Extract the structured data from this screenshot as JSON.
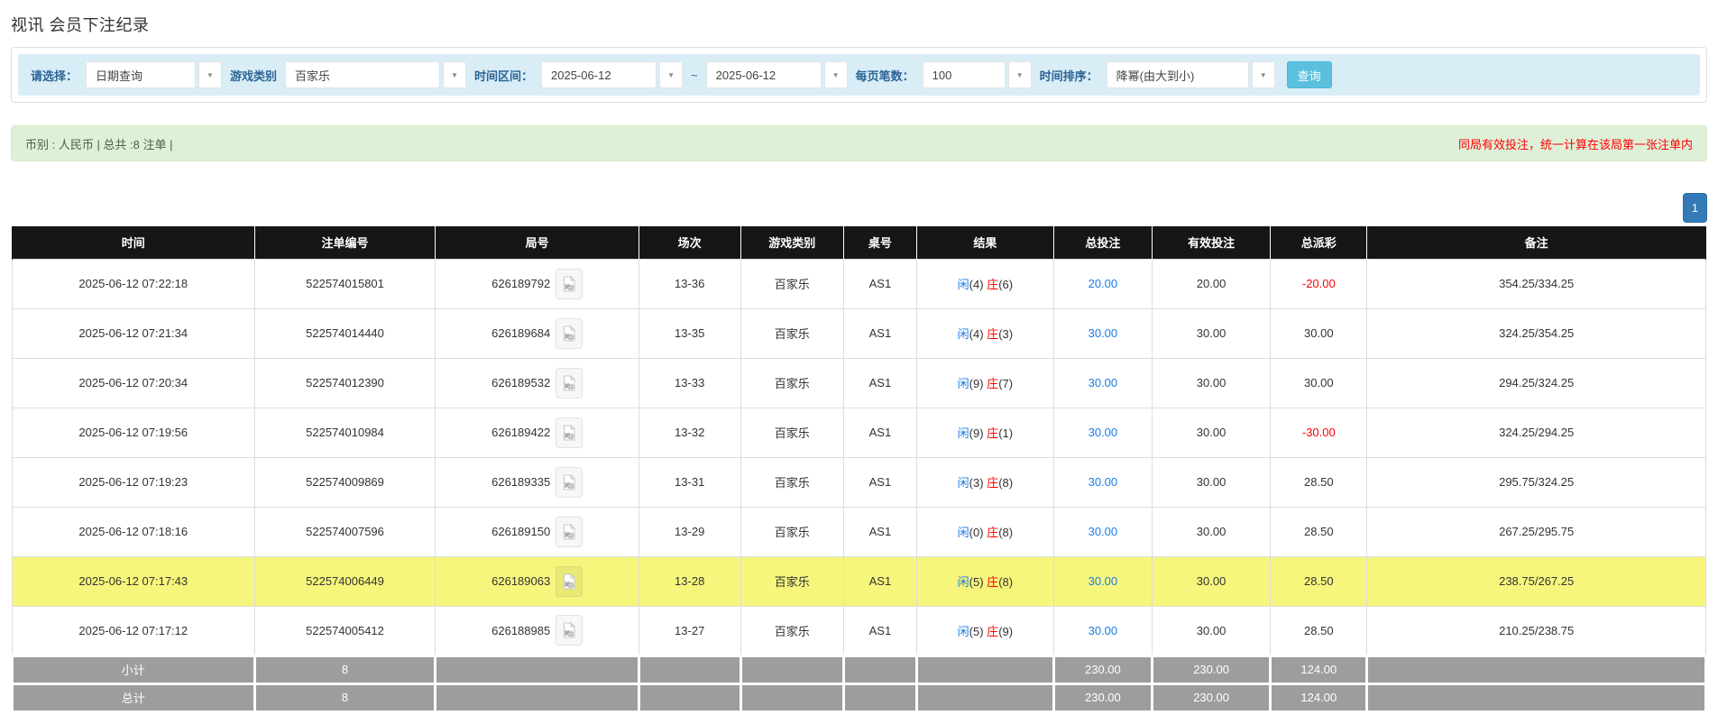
{
  "page": {
    "title": "视讯 会员下注纪录"
  },
  "filters": {
    "select_label": "请选择：",
    "select_value": "日期查询",
    "game_type_label": "游戏类别",
    "game_type_value": "百家乐",
    "date_range_label": "时间区间：",
    "date_from": "2025-06-12",
    "date_separator": "~",
    "date_to": "2025-06-12",
    "page_size_label": "每页笔数：",
    "page_size_value": "100",
    "sort_label": "时间排序：",
    "sort_value": "降幂(由大到小)",
    "search_button": "查询",
    "caret_glyph": "▼"
  },
  "summary": {
    "left_text": "币别 : 人民币 | 总共 :8 注单 |",
    "right_notice": "同局有效投注，统一计算在该局第一张注单内"
  },
  "pagination": {
    "current_page": "1"
  },
  "colors": {
    "accent_blue_link": "#1a7ce8",
    "negative_red": "#ff0000",
    "highlight_yellow": "#f6f67c",
    "header_black": "#161616",
    "footer_grey": "#9d9d9d",
    "filter_bar_blue": "#d9edf7",
    "summary_green": "#dff0d8",
    "search_button_cyan": "#5bc0de",
    "pagination_blue": "#337ab7"
  },
  "table": {
    "headers": [
      "时间",
      "注单编号",
      "局号",
      "场次",
      "游戏类别",
      "桌号",
      "结果",
      "总投注",
      "有效投注",
      "总派彩",
      "备注"
    ],
    "rows": [
      {
        "time": "2025-06-12 07:22:18",
        "bet_id": "522574015801",
        "round_id": "626189792",
        "session": "13-36",
        "game": "百家乐",
        "table_no": "AS1",
        "result_player_label": "闲",
        "result_player_num": "(4)",
        "result_banker_label": "庄",
        "result_banker_num": "(6)",
        "total_bet": "20.00",
        "valid_bet": "20.00",
        "payout": "-20.00",
        "remark": "354.25/334.25",
        "highlighted": false
      },
      {
        "time": "2025-06-12 07:21:34",
        "bet_id": "522574014440",
        "round_id": "626189684",
        "session": "13-35",
        "game": "百家乐",
        "table_no": "AS1",
        "result_player_label": "闲",
        "result_player_num": "(4)",
        "result_banker_label": "庄",
        "result_banker_num": "(3)",
        "total_bet": "30.00",
        "valid_bet": "30.00",
        "payout": "30.00",
        "remark": "324.25/354.25",
        "highlighted": false
      },
      {
        "time": "2025-06-12 07:20:34",
        "bet_id": "522574012390",
        "round_id": "626189532",
        "session": "13-33",
        "game": "百家乐",
        "table_no": "AS1",
        "result_player_label": "闲",
        "result_player_num": "(9)",
        "result_banker_label": "庄",
        "result_banker_num": "(7)",
        "total_bet": "30.00",
        "valid_bet": "30.00",
        "payout": "30.00",
        "remark": "294.25/324.25",
        "highlighted": false
      },
      {
        "time": "2025-06-12 07:19:56",
        "bet_id": "522574010984",
        "round_id": "626189422",
        "session": "13-32",
        "game": "百家乐",
        "table_no": "AS1",
        "result_player_label": "闲",
        "result_player_num": "(9)",
        "result_banker_label": "庄",
        "result_banker_num": "(1)",
        "total_bet": "30.00",
        "valid_bet": "30.00",
        "payout": "-30.00",
        "remark": "324.25/294.25",
        "highlighted": false
      },
      {
        "time": "2025-06-12 07:19:23",
        "bet_id": "522574009869",
        "round_id": "626189335",
        "session": "13-31",
        "game": "百家乐",
        "table_no": "AS1",
        "result_player_label": "闲",
        "result_player_num": "(3)",
        "result_banker_label": "庄",
        "result_banker_num": "(8)",
        "total_bet": "30.00",
        "valid_bet": "30.00",
        "payout": "28.50",
        "remark": "295.75/324.25",
        "highlighted": false
      },
      {
        "time": "2025-06-12 07:18:16",
        "bet_id": "522574007596",
        "round_id": "626189150",
        "session": "13-29",
        "game": "百家乐",
        "table_no": "AS1",
        "result_player_label": "闲",
        "result_player_num": "(0)",
        "result_banker_label": "庄",
        "result_banker_num": "(8)",
        "total_bet": "30.00",
        "valid_bet": "30.00",
        "payout": "28.50",
        "remark": "267.25/295.75",
        "highlighted": false
      },
      {
        "time": "2025-06-12 07:17:43",
        "bet_id": "522574006449",
        "round_id": "626189063",
        "session": "13-28",
        "game": "百家乐",
        "table_no": "AS1",
        "result_player_label": "闲",
        "result_player_num": "(5)",
        "result_banker_label": "庄",
        "result_banker_num": "(8)",
        "total_bet": "30.00",
        "valid_bet": "30.00",
        "payout": "28.50",
        "remark": "238.75/267.25",
        "highlighted": true
      },
      {
        "time": "2025-06-12 07:17:12",
        "bet_id": "522574005412",
        "round_id": "626188985",
        "session": "13-27",
        "game": "百家乐",
        "table_no": "AS1",
        "result_player_label": "闲",
        "result_player_num": "(5)",
        "result_banker_label": "庄",
        "result_banker_num": "(9)",
        "total_bet": "30.00",
        "valid_bet": "30.00",
        "payout": "28.50",
        "remark": "210.25/238.75",
        "highlighted": false
      }
    ],
    "subtotal": {
      "label": "小计",
      "count": "8",
      "total_bet": "230.00",
      "valid_bet": "230.00",
      "payout": "124.00"
    },
    "total": {
      "label": "总计",
      "count": "8",
      "total_bet": "230.00",
      "valid_bet": "230.00",
      "payout": "124.00"
    }
  }
}
